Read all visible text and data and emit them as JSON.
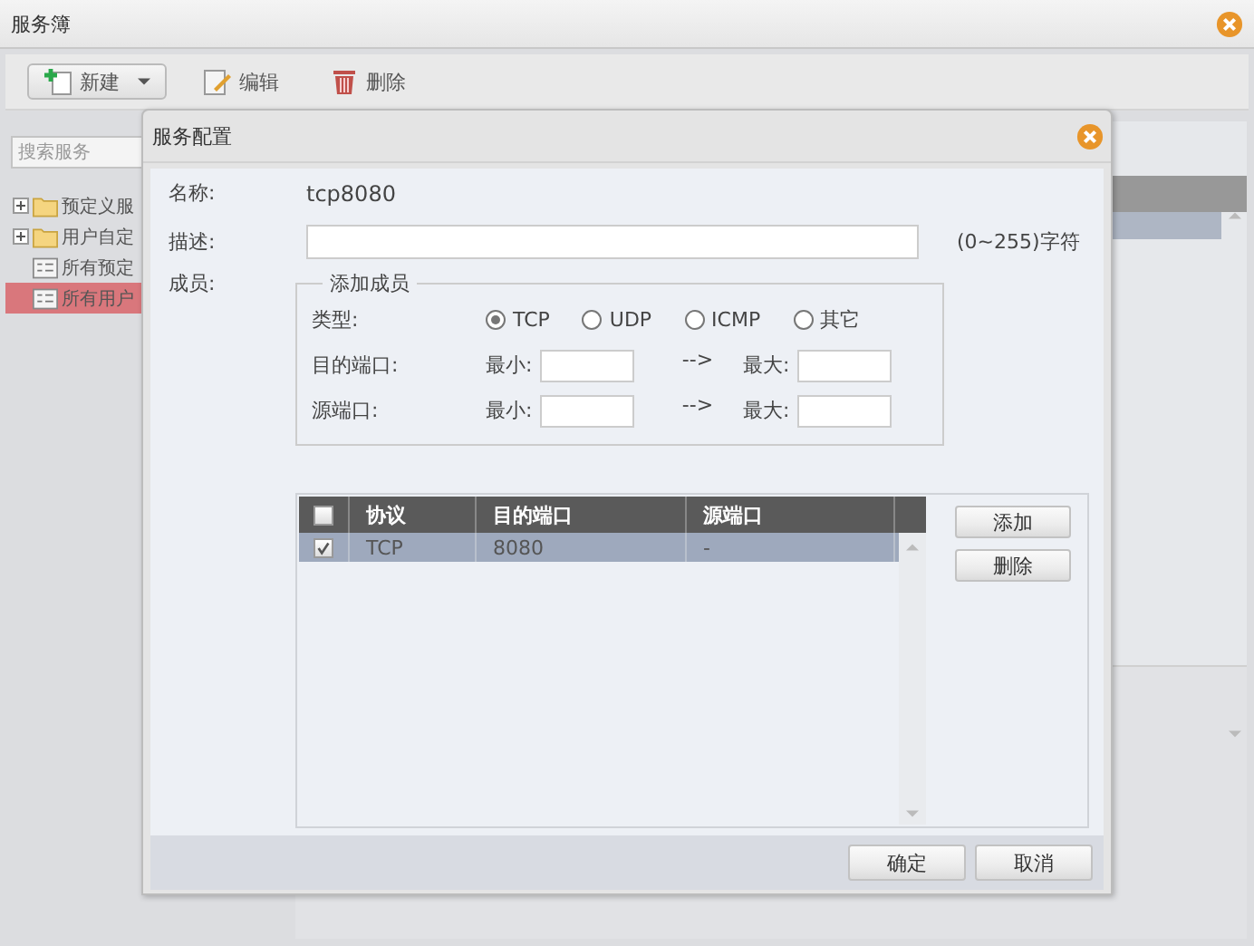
{
  "window": {
    "title": "服务簿"
  },
  "toolbar": [
    {
      "kind": "new",
      "label": "新建"
    },
    {
      "kind": "edit",
      "label": "编辑"
    },
    {
      "kind": "delete",
      "label": "删除"
    }
  ],
  "sidebar": {
    "search": {
      "placeholder": "搜索服务"
    },
    "tree": [
      {
        "kind": "folder",
        "label": "预定义服",
        "selected": false,
        "expanded": false
      },
      {
        "kind": "folder",
        "label": "用户自定",
        "selected": false,
        "expanded": false
      },
      {
        "kind": "list",
        "label": "所有预定",
        "selected": false
      },
      {
        "kind": "list",
        "label": "所有用户",
        "selected": true
      }
    ]
  },
  "dialog": {
    "title": "服务配置",
    "name": {
      "label": "名称:",
      "value": "tcp8080"
    },
    "description": {
      "label": "描述:",
      "hint": "(0~255)字符"
    },
    "members": {
      "label": "成员:",
      "legend": "添加成员",
      "type_label": "类型:",
      "types": [
        {
          "label": "TCP",
          "selected": true
        },
        {
          "label": "UDP",
          "selected": false
        },
        {
          "label": "ICMP",
          "selected": false
        },
        {
          "label": "其它",
          "selected": false
        }
      ],
      "ports": [
        {
          "label": "目的端口:",
          "min": "最小:",
          "arrow": "-->",
          "max": "最大:"
        },
        {
          "label": "源端口:",
          "min": "最小:",
          "arrow": "-->",
          "max": "最大:"
        }
      ]
    },
    "table": {
      "header_checked": false,
      "columns": [
        "协议",
        "目的端口",
        "源端口"
      ],
      "rows": [
        {
          "checked": true,
          "selected": true,
          "cells": [
            "TCP",
            "8080",
            "-"
          ]
        }
      ]
    },
    "side_buttons": [
      "添加",
      "删除"
    ],
    "buttons": [
      "确定",
      "取消"
    ]
  }
}
